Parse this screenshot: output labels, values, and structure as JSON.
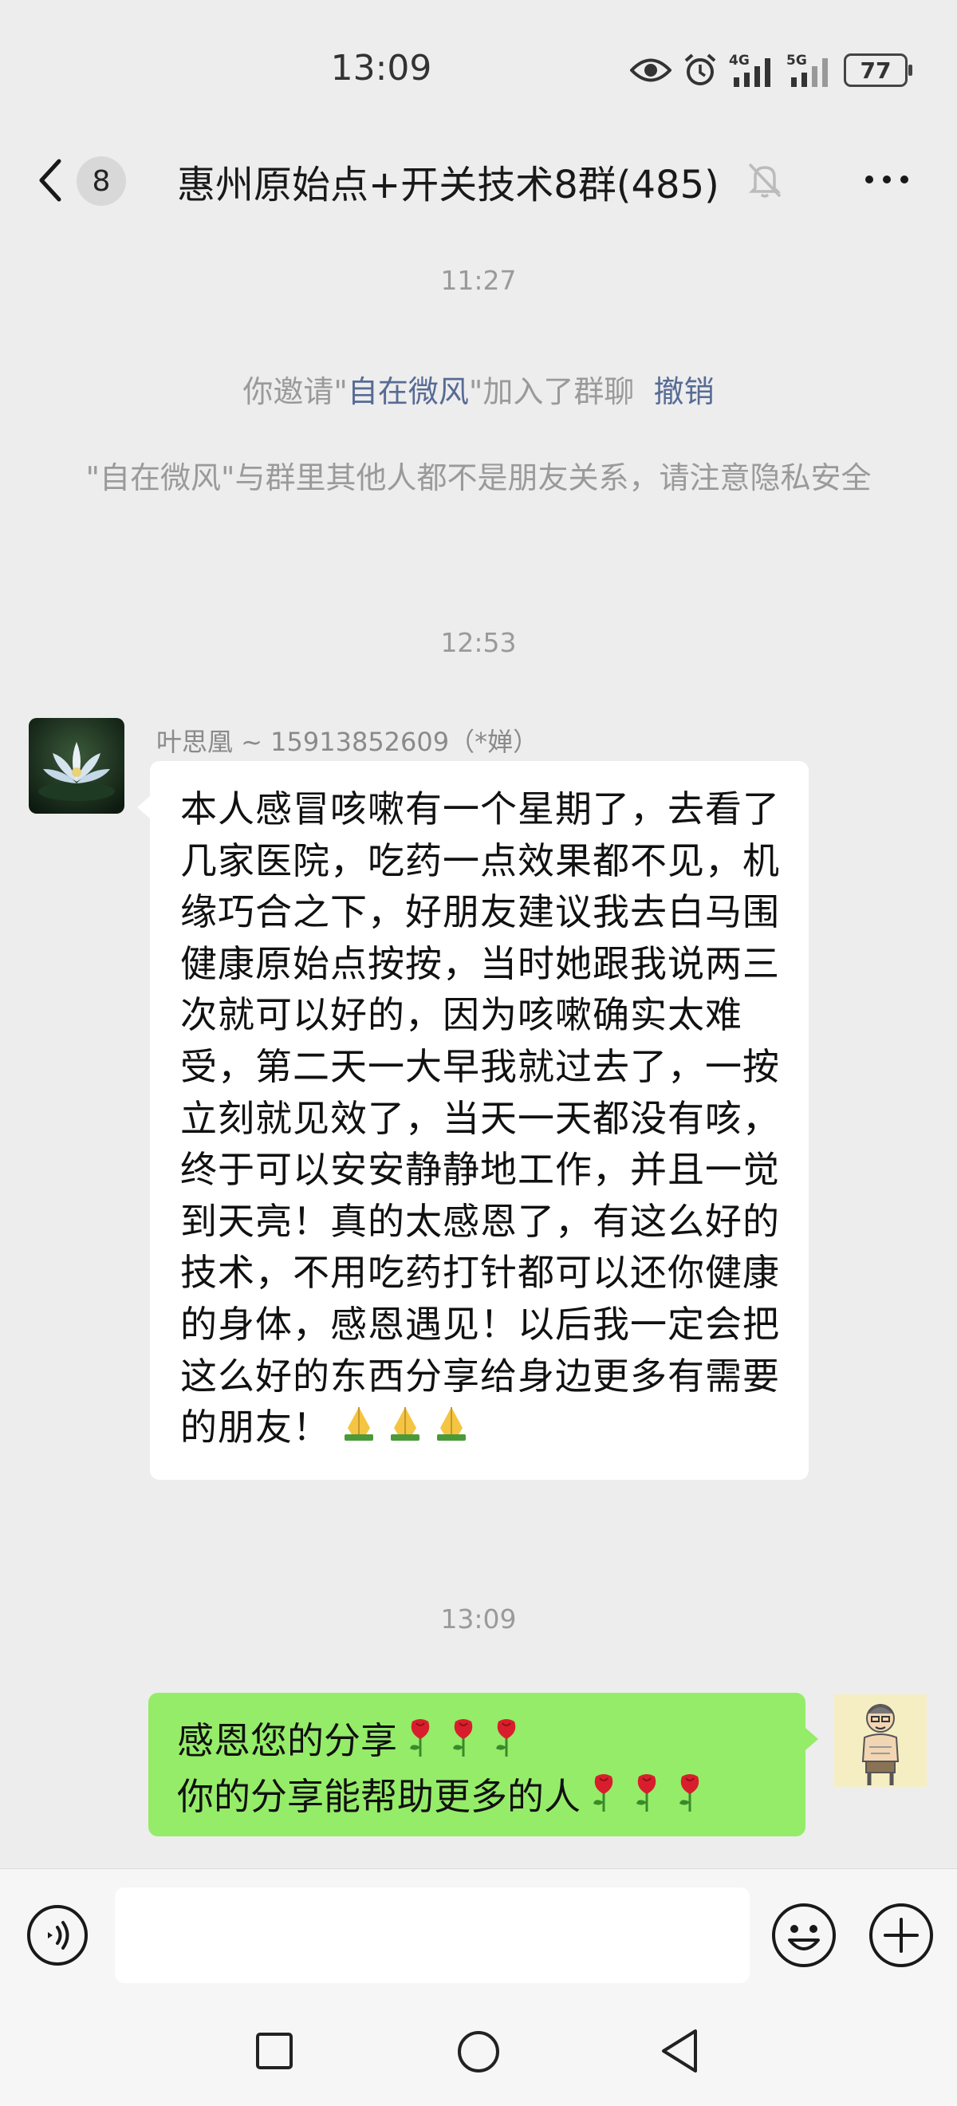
{
  "status_bar": {
    "time": "13:09",
    "battery": "77",
    "icons": [
      "eye-icon",
      "alarm-icon",
      "signal-4g-icon",
      "signal-5g-icon",
      "battery-icon"
    ],
    "network_4g": "4G",
    "network_5g": "5G"
  },
  "header": {
    "unread_count": "8",
    "title": "惠州原始点+开关技术8群(485)",
    "icons": [
      "back-icon",
      "mute-icon",
      "more-icon"
    ]
  },
  "messages": {
    "time_1": "11:27",
    "invite_prefix": "你邀请\"",
    "invite_name": "自在微风",
    "invite_suffix": "\"加入了群聊",
    "revoke_label": "撤销",
    "privacy_notice": "\"自在微风\"与群里其他人都不是朋友关系，请注意隐私安全",
    "time_2": "12:53",
    "sender_name": "叶思凰 ~ 15913852609（*婵）",
    "message_1": "本人感冒咳嗽有一个星期了，去看了几家医院，吃药一点效果都不见，机缘巧合之下，好朋友建议我去白马围健康原始点按按，当时她跟我说两三次就可以好的，因为咳嗽确实太难受，第二天一大早我就过去了，一按立刻就见效了，当天一天都没有咳，终于可以安安静静地工作，并且一觉到天亮！真的太感恩了，有这么好的技术，不用吃药打针都可以还你健康的身体，感恩遇见！以后我一定会把这么好的东西分享给身边更多有需要的朋友！",
    "message_1_emoji": "🙏🙏🙏",
    "time_3": "13:09",
    "my_message_line_1": "感恩您的分享",
    "my_message_line_2": "你的分享能帮助更多的人",
    "my_message_emoji": "🌹🌹🌹"
  },
  "input_bar": {
    "icons": [
      "voice-icon",
      "emoji-icon",
      "plus-icon"
    ],
    "text_value": ""
  },
  "nav_bar": {
    "icons": [
      "recents-icon",
      "home-icon",
      "back-nav-icon"
    ]
  },
  "colors": {
    "background": "#ededed",
    "my_bubble": "#95ec69",
    "their_bubble": "#ffffff",
    "link": "#576b95",
    "system_text": "#9a9a9a"
  }
}
